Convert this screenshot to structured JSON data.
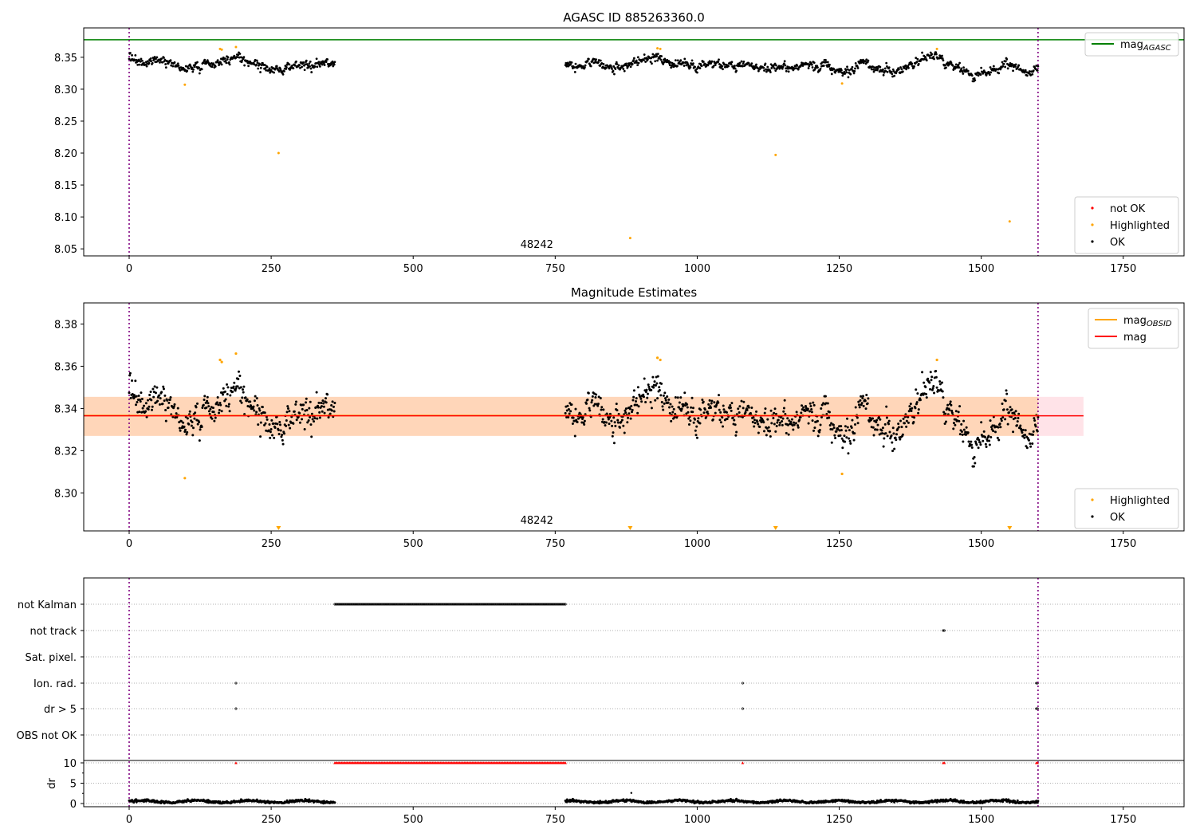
{
  "chart_data": [
    {
      "type": "scatter",
      "title": "AGASC ID 885263360.0",
      "xlim": [
        -80,
        1857
      ],
      "ylim": [
        8.039,
        8.396
      ],
      "xticks": [
        0,
        250,
        500,
        750,
        1000,
        1250,
        1500,
        1750
      ],
      "yticks": [
        8.05,
        8.1,
        8.15,
        8.2,
        8.25,
        8.3,
        8.35
      ],
      "ytick_labels": [
        "8.05",
        "8.10",
        "8.15",
        "8.20",
        "8.25",
        "8.30",
        "8.35"
      ],
      "mag_agasc": 8.3775,
      "vlines": [
        0,
        1600
      ],
      "annotation": {
        "text": "48242",
        "x": 770,
        "y": 8.05
      },
      "legend_top": {
        "position": "top-right",
        "entries": [
          {
            "label": "mag",
            "sub": "AGASC",
            "color": "#008000"
          }
        ]
      },
      "legend_bottom": {
        "position": "bottom-right",
        "entries": [
          {
            "label": "not OK",
            "color": "#ff0000"
          },
          {
            "label": "Highlighted",
            "color": "#ffa500"
          },
          {
            "label": "OK",
            "color": "#000000"
          }
        ]
      }
    },
    {
      "type": "scatter",
      "title": "Magnitude Estimates",
      "xlim": [
        -80,
        1857
      ],
      "ylim": [
        8.282,
        8.39
      ],
      "xticks": [
        0,
        250,
        500,
        750,
        1000,
        1250,
        1500,
        1750
      ],
      "yticks": [
        8.3,
        8.32,
        8.34,
        8.36,
        8.38
      ],
      "ytick_labels": [
        "8.30",
        "8.32",
        "8.34",
        "8.36",
        "8.38"
      ],
      "mag": 8.3365,
      "band": [
        8.327,
        8.3455
      ],
      "band_obs_x": [
        -80,
        1600
      ],
      "band_total_x": [
        -80,
        1680
      ],
      "vlines": [
        0,
        1600
      ],
      "annotation": {
        "text": "48242",
        "x": 770
      },
      "legend_top": {
        "position": "top-right",
        "entries": [
          {
            "label": "mag",
            "sub": "OBSID",
            "color": "#ffa500"
          },
          {
            "label": "mag",
            "sub": "",
            "color": "#ff0000"
          }
        ]
      },
      "legend_bottom": {
        "position": "bottom-right",
        "entries": [
          {
            "label": "Highlighted",
            "color": "#ffa500"
          },
          {
            "label": "OK",
            "color": "#000000"
          }
        ]
      }
    },
    {
      "type": "scatter",
      "title": "",
      "xlim": [
        -80,
        1857
      ],
      "xticks": [
        0,
        250,
        500,
        750,
        1000,
        1250,
        1500,
        1750
      ],
      "flag_rows": [
        "not Kalman",
        "not track",
        "Sat. pixel.",
        "Ion. rad.",
        "dr > 5",
        "OBS not OK"
      ],
      "flags": {
        "not Kalman": [
          [
            362,
            768
          ]
        ],
        "not track": [
          [
            1433,
            1436
          ]
        ],
        "Sat. pixel.": [],
        "Ion. rad.": [
          [
            188,
            188
          ],
          [
            1080,
            1080
          ],
          [
            1597,
            1600
          ]
        ],
        "dr > 5": [
          [
            188,
            188
          ],
          [
            1080,
            1080
          ],
          [
            1597,
            1600
          ]
        ],
        "OBS not OK": []
      },
      "dr_ylabel": "dr",
      "dr_ylim": [
        -0.6,
        10.6
      ],
      "dr_yticks": [
        0,
        5,
        10
      ],
      "dr_clipped_at": 10,
      "dr_typical": 0.5,
      "dr_outliers": [
        [
          884,
          2.6
        ]
      ],
      "vlines": [
        0,
        1600
      ]
    }
  ],
  "series": {
    "segments": [
      [
        0,
        362
      ],
      [
        768,
        1600
      ]
    ],
    "trend_knots": [
      [
        0,
        8.347
      ],
      [
        30,
        8.343
      ],
      [
        60,
        8.343
      ],
      [
        100,
        8.33
      ],
      [
        130,
        8.337
      ],
      [
        160,
        8.345
      ],
      [
        185,
        8.35
      ],
      [
        210,
        8.343
      ],
      [
        240,
        8.332
      ],
      [
        300,
        8.337
      ],
      [
        362,
        8.338
      ],
      [
        768,
        8.336
      ],
      [
        820,
        8.338
      ],
      [
        860,
        8.333
      ],
      [
        900,
        8.343
      ],
      [
        935,
        8.35
      ],
      [
        970,
        8.34
      ],
      [
        1000,
        8.336
      ],
      [
        1050,
        8.34
      ],
      [
        1100,
        8.333
      ],
      [
        1150,
        8.33
      ],
      [
        1190,
        8.34
      ],
      [
        1220,
        8.338
      ],
      [
        1260,
        8.322
      ],
      [
        1290,
        8.346
      ],
      [
        1320,
        8.33
      ],
      [
        1350,
        8.326
      ],
      [
        1380,
        8.34
      ],
      [
        1420,
        8.35
      ],
      [
        1450,
        8.335
      ],
      [
        1490,
        8.325
      ],
      [
        1520,
        8.328
      ],
      [
        1550,
        8.345
      ],
      [
        1580,
        8.325
      ],
      [
        1600,
        8.332
      ]
    ],
    "noise_sigma": 0.0045,
    "highlighted": [
      [
        98,
        8.307
      ],
      [
        160,
        8.363
      ],
      [
        163,
        8.362
      ],
      [
        188,
        8.366
      ],
      [
        263,
        8.2
      ],
      [
        882,
        8.067
      ],
      [
        930,
        8.364
      ],
      [
        935,
        8.363
      ],
      [
        1138,
        8.197
      ],
      [
        1255,
        8.309
      ],
      [
        1422,
        8.363
      ],
      [
        1550,
        8.093
      ]
    ]
  }
}
